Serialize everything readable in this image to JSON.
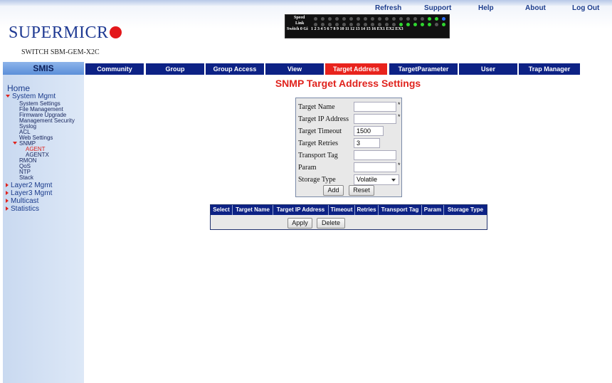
{
  "header": {
    "links": [
      "Refresh",
      "Support",
      "Help",
      "About",
      "Log Out"
    ],
    "logo_text": "SUPERMICR",
    "switch_name": "SWITCH SBM-GEM-X2C",
    "panel": {
      "row_labels": [
        "Speed",
        "Link",
        "Switch 0 Gi"
      ],
      "port_numbers": "1 2 3 4 5 6 7 8 9 10 11 12 13 14 15 16 EX1 EX2 EX3"
    }
  },
  "nav": {
    "smis_label": "SMIS",
    "tabs": [
      "Community",
      "Group",
      "Group Access",
      "View",
      "Target Address",
      "TargetParameter",
      "User",
      "Trap Manager"
    ],
    "active_tab": "Target Address"
  },
  "sidebar": {
    "home": "Home",
    "system_mgmt": "System Mgmt",
    "system_items": [
      "System Settings",
      "File Management",
      "Firmware Upgrade",
      "Management Security",
      "Syslog",
      "ACL",
      "Web Settings"
    ],
    "snmp": "SNMP",
    "snmp_items": [
      "AGENT",
      "AGENTX"
    ],
    "more_items": [
      "RMON",
      "QoS",
      "NTP",
      "Stack"
    ],
    "collapsed_sections": [
      "Layer2 Mgmt",
      "Layer3 Mgmt",
      "Multicast",
      "Statistics"
    ]
  },
  "main": {
    "title": "SNMP Target Address Settings",
    "form": {
      "target_name_label": "Target Name",
      "target_name_value": "",
      "target_ip_label": "Target IP Address",
      "target_ip_value": "",
      "timeout_label": "Target Timeout",
      "timeout_value": "1500",
      "retries_label": "Target Retries",
      "retries_value": "3",
      "tag_label": "Transport Tag",
      "tag_value": "",
      "param_label": "Param",
      "param_value": "",
      "storage_label": "Storage Type",
      "storage_value": "Volatile",
      "required_mark": "*",
      "add_label": "Add",
      "reset_label": "Reset"
    },
    "table": {
      "columns": [
        "Select",
        "Target Name",
        "Target IP Address",
        "Timeout",
        "Retries",
        "Transport Tag",
        "Param",
        "Storage Type"
      ],
      "apply_label": "Apply",
      "delete_label": "Delete"
    }
  },
  "colors": {
    "nav_blue": "#0d2285",
    "active_red": "#e8231d",
    "sidebar_bg": "#c9d9f0",
    "title_red": "#e0231d"
  }
}
